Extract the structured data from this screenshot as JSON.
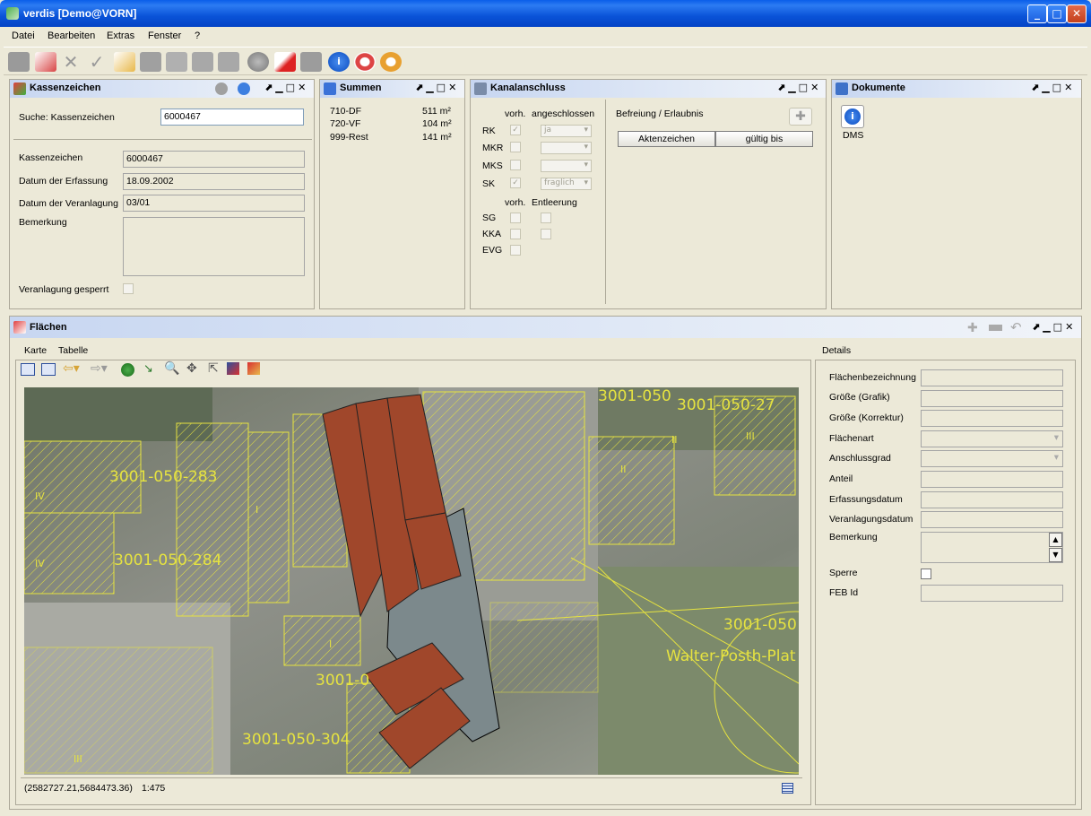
{
  "window": {
    "title": "verdis [Demo@VORN]"
  },
  "menu": [
    "Datei",
    "Bearbeiten",
    "Extras",
    "Fenster",
    "?"
  ],
  "kassen": {
    "title": "Kassenzeichen",
    "search_label": "Suche: Kassenzeichen",
    "search_value": "6000467",
    "labels": [
      "Kassenzeichen",
      "Datum der Erfassung",
      "Datum der Veranlagung",
      "Bemerkung"
    ],
    "values": [
      "6000467",
      "18.09.2002",
      "03/01",
      ""
    ],
    "locked_label": "Veranlagung gesperrt"
  },
  "summen": {
    "title": "Summen",
    "rows": [
      {
        "name": "710-DF",
        "value": "511 m²"
      },
      {
        "name": "720-VF",
        "value": "104 m²"
      },
      {
        "name": "999-Rest",
        "value": "141 m²"
      }
    ]
  },
  "kanal": {
    "title": "Kanalanschluss",
    "head1": "vorh.",
    "head2": "angeschlossen",
    "rows": [
      {
        "name": "RK",
        "checked": true,
        "status": "ja"
      },
      {
        "name": "MKR",
        "checked": false,
        "status": ""
      },
      {
        "name": "MKS",
        "checked": false,
        "status": ""
      },
      {
        "name": "SK",
        "checked": true,
        "status": "fraglich"
      }
    ],
    "head3": "vorh.",
    "head4": "Entleerung",
    "rows2": [
      "SG",
      "KKA",
      "EVG"
    ],
    "befreiung": "Befreiung / Erlaubnis",
    "col1": "Aktenzeichen",
    "col2": "gültig bis"
  },
  "dokumente": {
    "title": "Dokumente",
    "dms": "DMS"
  },
  "flaechen": {
    "title": "Flächen",
    "tab1": "Karte",
    "tab2": "Tabelle",
    "details_tab": "Details",
    "status_coords": "(2582727.21,5684473.36)",
    "status_scale": "1:475"
  },
  "map_labels": [
    "3001-050-283",
    "3001-050-284",
    "3001-050-304",
    "3001-0",
    "3001-050",
    "3001-050-27",
    "3001-050",
    "Walter-Posth-Plat",
    "II",
    "II",
    "IV",
    "IV",
    "I",
    "I",
    "III",
    "III"
  ],
  "details": {
    "labels": [
      "Flächenbezeichnung",
      "Größe (Grafik)",
      "Größe (Korrektur)",
      "Flächenart",
      "Anschlussgrad",
      "Anteil",
      "Erfassungsdatum",
      "Veranlagungsdatum",
      "Bemerkung",
      "Sperre",
      "FEB Id"
    ]
  }
}
